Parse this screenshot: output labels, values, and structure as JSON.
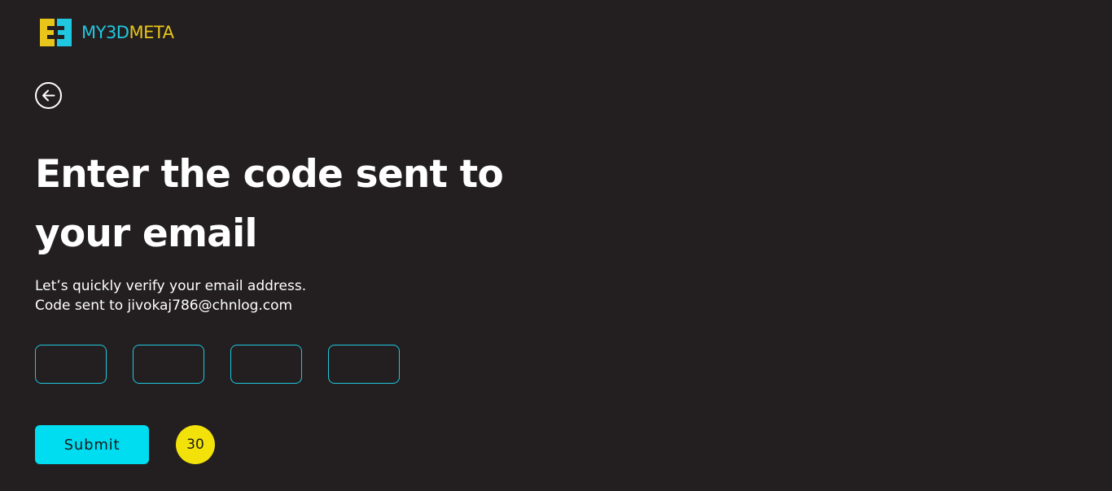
{
  "brand": {
    "name_part1": "MY3D",
    "name_part2": "META",
    "logo_icon": "my3dmeta-logo-icon",
    "color_primary": "#1fc8e0",
    "color_secondary": "#e8c51a"
  },
  "nav": {
    "back_icon": "arrow-left-circle-icon"
  },
  "verify": {
    "title_line1": "Enter the code sent to",
    "title_line2": "your email",
    "instruction": "Let’s quickly verify your email address.",
    "code_sent_line": "Code sent to jivokaj786@chnlog.com",
    "otp_fields": [
      {
        "value": "",
        "placeholder": ""
      },
      {
        "value": "",
        "placeholder": ""
      },
      {
        "value": "",
        "placeholder": ""
      },
      {
        "value": "",
        "placeholder": ""
      }
    ],
    "submit_label": "Submit",
    "countdown": "30"
  },
  "colors": {
    "background": "#231f20",
    "accent": "#00dcf0",
    "timer": "#f2e20a",
    "input_border": "#1ec8e0"
  }
}
